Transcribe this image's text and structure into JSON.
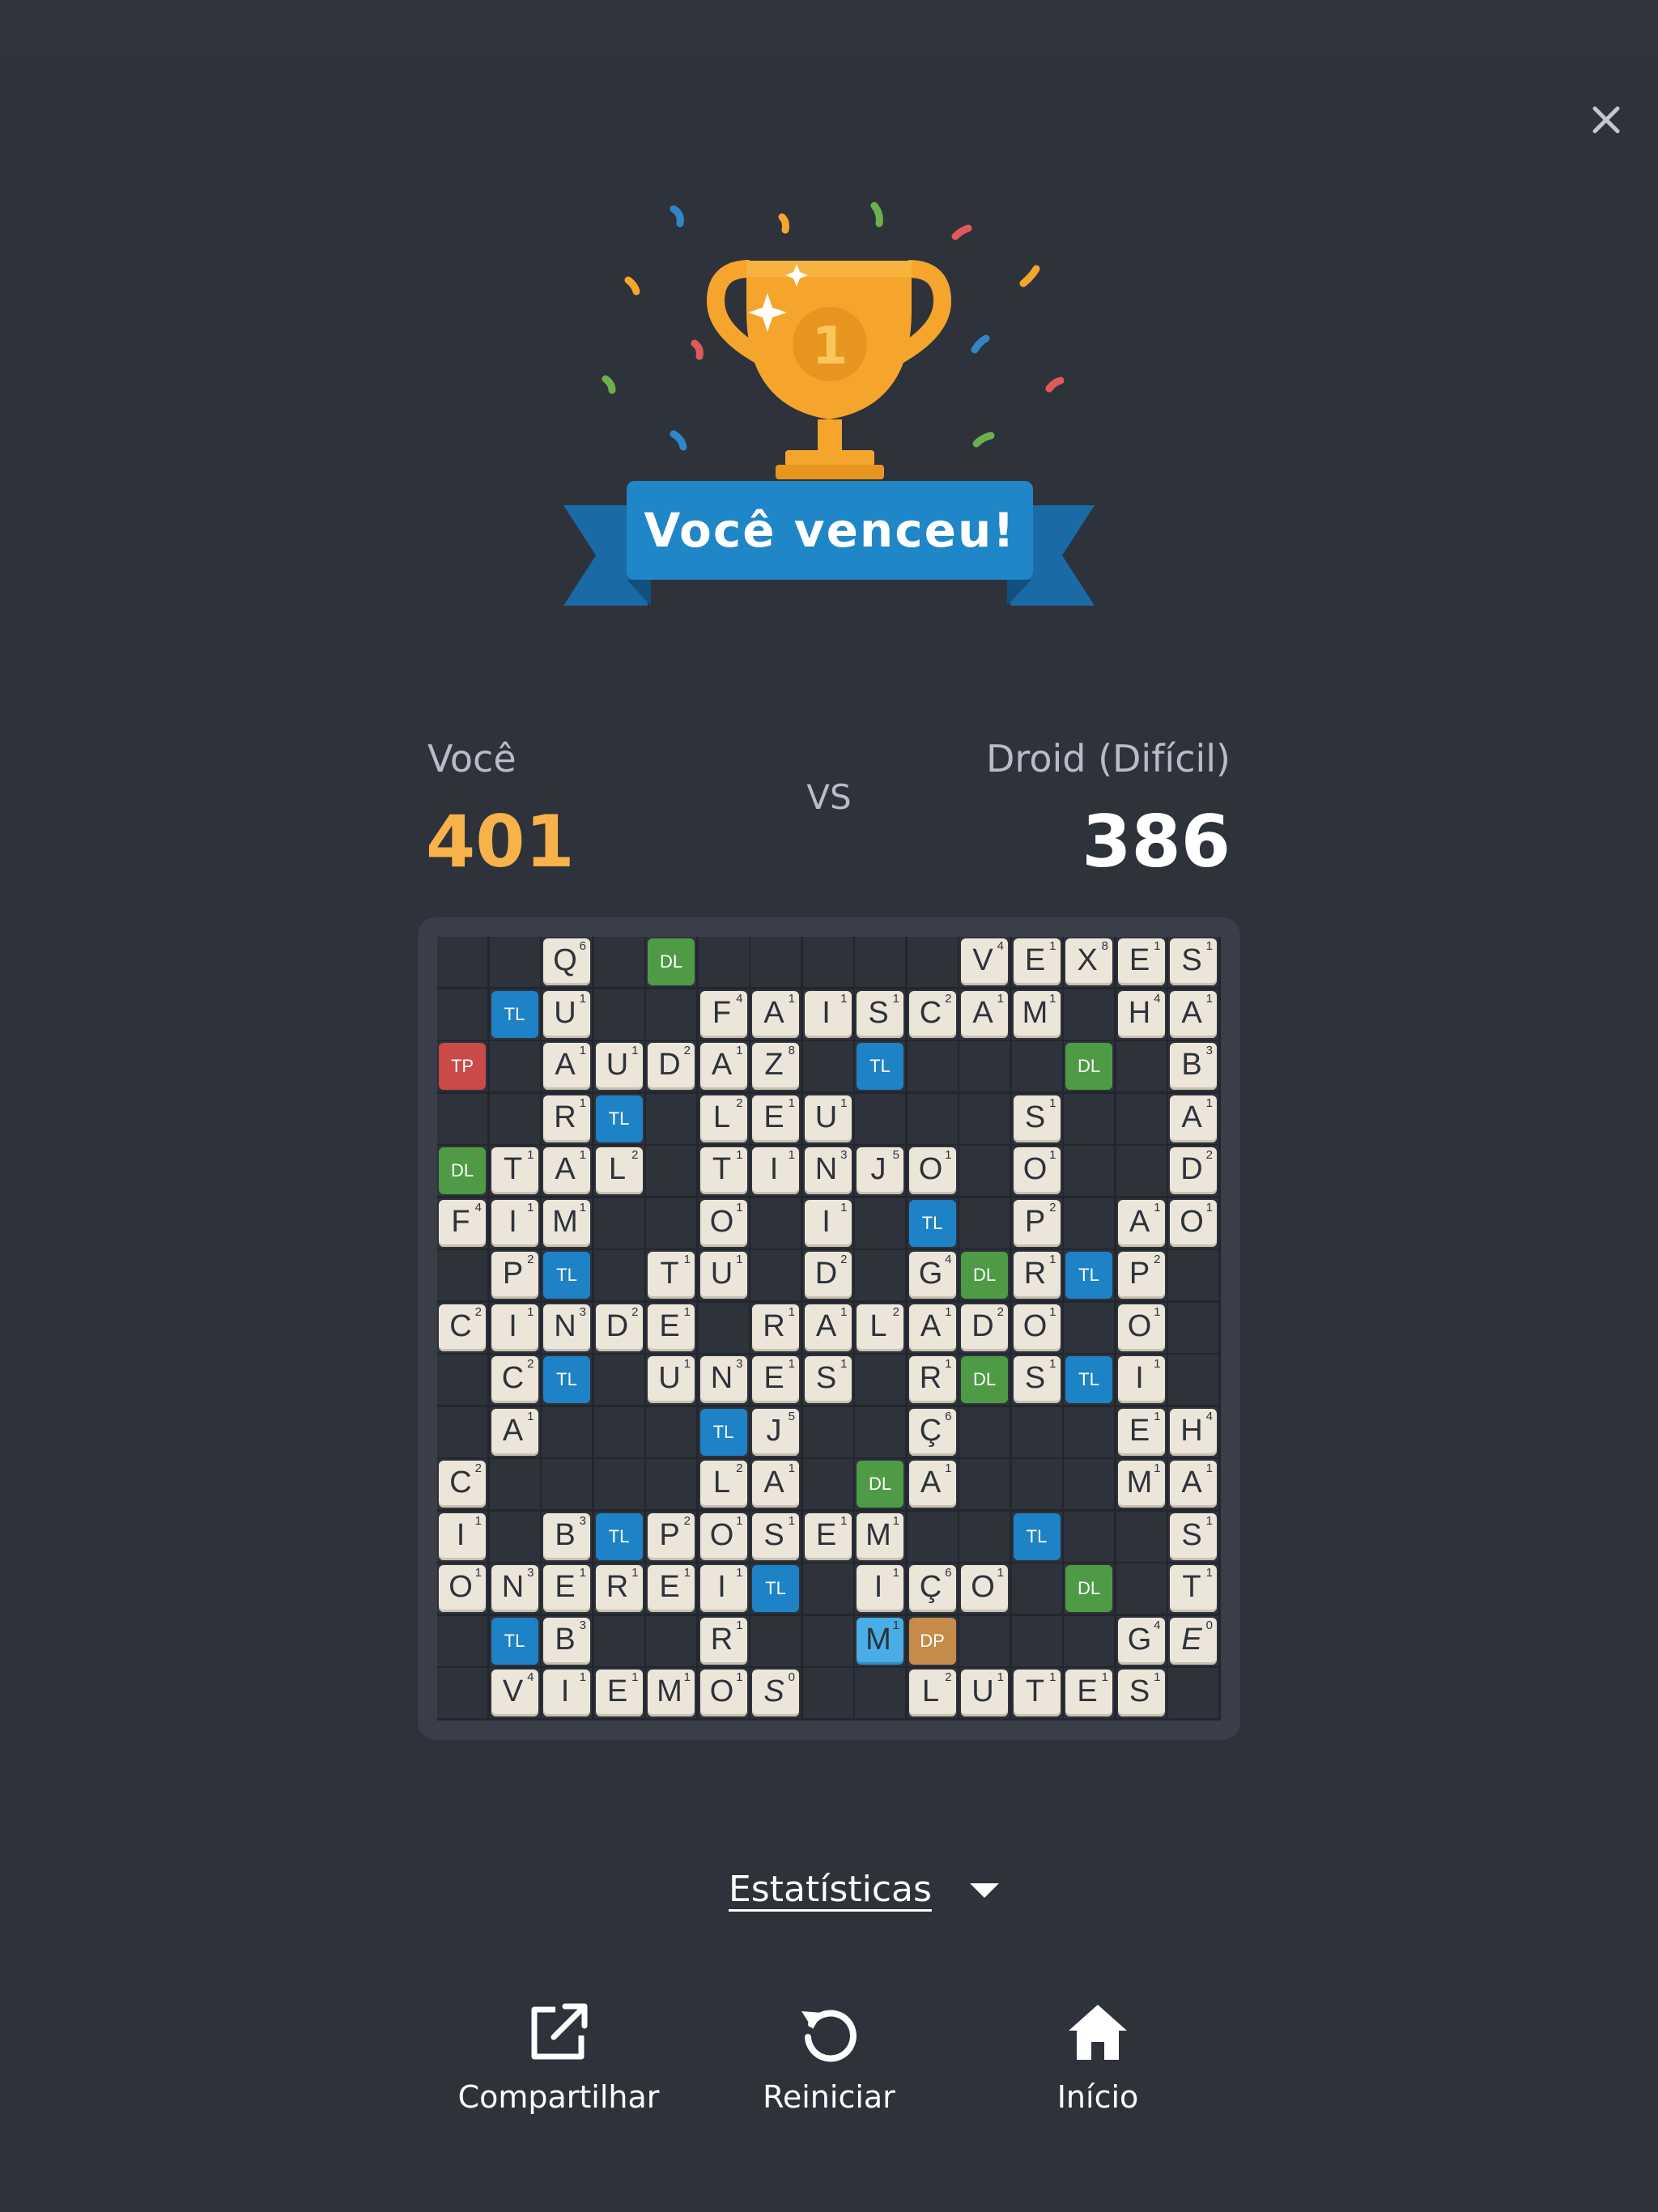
{
  "result": {
    "banner": "Você venceu!",
    "trophy_rank": "1"
  },
  "players": {
    "you": {
      "name": "Você",
      "score": "401"
    },
    "vs": "VS",
    "opponent": {
      "name": "Droid (Difícil)",
      "score": "386"
    }
  },
  "board": {
    "rows": [
      [
        null,
        null,
        [
          "Q",
          "6"
        ],
        null,
        [
          "DL"
        ],
        null,
        null,
        null,
        null,
        null,
        [
          "V",
          "4"
        ],
        [
          "E",
          "1"
        ],
        [
          "X",
          "8"
        ],
        [
          "E",
          "1"
        ],
        [
          "S",
          "1"
        ]
      ],
      [
        null,
        [
          "TL"
        ],
        [
          "U",
          "1"
        ],
        null,
        null,
        [
          "F",
          "4"
        ],
        [
          "A",
          "1"
        ],
        [
          "I",
          "1"
        ],
        [
          "S",
          "1"
        ],
        [
          "C",
          "2"
        ],
        [
          "A",
          "1"
        ],
        [
          "M",
          "1"
        ],
        null,
        [
          "H",
          "4"
        ],
        [
          "A",
          "1"
        ]
      ],
      [
        [
          "TP"
        ],
        null,
        [
          "A",
          "1"
        ],
        [
          "U",
          "1"
        ],
        [
          "D",
          "2"
        ],
        [
          "A",
          "1"
        ],
        [
          "Z",
          "8"
        ],
        null,
        [
          "TL"
        ],
        null,
        null,
        null,
        [
          "DL"
        ],
        null,
        [
          "B",
          "3"
        ]
      ],
      [
        null,
        null,
        [
          "R",
          "1"
        ],
        [
          "TL"
        ],
        null,
        [
          "L",
          "2"
        ],
        [
          "E",
          "1"
        ],
        [
          "U",
          "1"
        ],
        null,
        null,
        null,
        [
          "S",
          "1"
        ],
        null,
        null,
        [
          "A",
          "1"
        ]
      ],
      [
        [
          "DL"
        ],
        [
          "T",
          "1"
        ],
        [
          "A",
          "1"
        ],
        [
          "L",
          "2"
        ],
        null,
        [
          "T",
          "1"
        ],
        [
          "I",
          "1"
        ],
        [
          "N",
          "3"
        ],
        [
          "J",
          "5"
        ],
        [
          "O",
          "1"
        ],
        null,
        [
          "O",
          "1"
        ],
        null,
        null,
        [
          "D",
          "2"
        ]
      ],
      [
        [
          "F",
          "4"
        ],
        [
          "I",
          "1"
        ],
        [
          "M",
          "1"
        ],
        null,
        null,
        [
          "O",
          "1"
        ],
        null,
        [
          "I",
          "1"
        ],
        null,
        [
          "TL"
        ],
        null,
        [
          "P",
          "2"
        ],
        null,
        [
          "A",
          "1"
        ],
        [
          "O",
          "1"
        ]
      ],
      [
        null,
        [
          "P",
          "2"
        ],
        [
          "TL"
        ],
        null,
        [
          "T",
          "1"
        ],
        [
          "U",
          "1"
        ],
        null,
        [
          "D",
          "2"
        ],
        null,
        [
          "G",
          "4"
        ],
        [
          "DL"
        ],
        [
          "R",
          "1"
        ],
        [
          "TL"
        ],
        [
          "P",
          "2"
        ],
        null
      ],
      [
        [
          "C",
          "2"
        ],
        [
          "I",
          "1"
        ],
        [
          "N",
          "3"
        ],
        [
          "D",
          "2"
        ],
        [
          "E",
          "1"
        ],
        null,
        [
          "R",
          "1"
        ],
        [
          "A",
          "1"
        ],
        [
          "L",
          "2"
        ],
        [
          "A",
          "1"
        ],
        [
          "D",
          "2"
        ],
        [
          "O",
          "1"
        ],
        null,
        [
          "O",
          "1"
        ],
        null
      ],
      [
        null,
        [
          "C",
          "2"
        ],
        [
          "TL"
        ],
        null,
        [
          "U",
          "1"
        ],
        [
          "N",
          "3"
        ],
        [
          "E",
          "1"
        ],
        [
          "S",
          "1"
        ],
        null,
        [
          "R",
          "1"
        ],
        [
          "DL"
        ],
        [
          "S",
          "1"
        ],
        [
          "TL"
        ],
        [
          "I",
          "1"
        ],
        null
      ],
      [
        null,
        [
          "A",
          "1"
        ],
        null,
        null,
        null,
        [
          "TL"
        ],
        [
          "J",
          "5"
        ],
        null,
        null,
        [
          "Ç",
          "6"
        ],
        null,
        null,
        null,
        [
          "E",
          "1"
        ],
        [
          "H",
          "4"
        ]
      ],
      [
        [
          "C",
          "2"
        ],
        null,
        null,
        null,
        null,
        [
          "L",
          "2"
        ],
        [
          "A",
          "1"
        ],
        null,
        [
          "DL"
        ],
        [
          "A",
          "1"
        ],
        null,
        null,
        null,
        [
          "M",
          "1"
        ],
        [
          "A",
          "1"
        ]
      ],
      [
        [
          "I",
          "1"
        ],
        null,
        [
          "B",
          "3"
        ],
        [
          "TL"
        ],
        [
          "P",
          "2"
        ],
        [
          "O",
          "1"
        ],
        [
          "S",
          "1"
        ],
        [
          "E",
          "1"
        ],
        [
          "M",
          "1"
        ],
        null,
        null,
        [
          "TL"
        ],
        null,
        null,
        [
          "S",
          "1"
        ]
      ],
      [
        [
          "O",
          "1"
        ],
        [
          "N",
          "3"
        ],
        [
          "E",
          "1"
        ],
        [
          "R",
          "1"
        ],
        [
          "E",
          "1"
        ],
        [
          "I",
          "1"
        ],
        [
          "TL"
        ],
        null,
        [
          "I",
          "1"
        ],
        [
          "Ç",
          "6"
        ],
        [
          "O",
          "1"
        ],
        null,
        [
          "DL"
        ],
        null,
        [
          "T",
          "1"
        ]
      ],
      [
        null,
        [
          "TL"
        ],
        [
          "B",
          "3"
        ],
        null,
        null,
        [
          "R",
          "1"
        ],
        null,
        null,
        [
          "M",
          "1",
          "hl"
        ],
        [
          "DP"
        ],
        null,
        null,
        null,
        [
          "G",
          "4"
        ],
        [
          "E",
          "0",
          "blank"
        ]
      ],
      [
        null,
        [
          "V",
          "4"
        ],
        [
          "I",
          "1"
        ],
        [
          "E",
          "1"
        ],
        [
          "M",
          "1"
        ],
        [
          "O",
          "1"
        ],
        [
          "S",
          "0",
          "blank"
        ],
        null,
        null,
        [
          "L",
          "2"
        ],
        [
          "U",
          "1"
        ],
        [
          "T",
          "1"
        ],
        [
          "E",
          "1"
        ],
        [
          "S",
          "1"
        ],
        null
      ]
    ]
  },
  "stats": {
    "label": "Estatísticas"
  },
  "actions": {
    "share": "Compartilhar",
    "restart": "Reiniciar",
    "home": "Início"
  },
  "colors": {
    "background": "#2e323b",
    "your_score": "#f7b24a",
    "banner": "#1f86c8",
    "trophy": "#f6a52c",
    "tile": "#ece6da",
    "TL": "#1d82c6",
    "DL": "#4e9a45",
    "TP": "#c94a47",
    "DP": "#c78b49"
  }
}
